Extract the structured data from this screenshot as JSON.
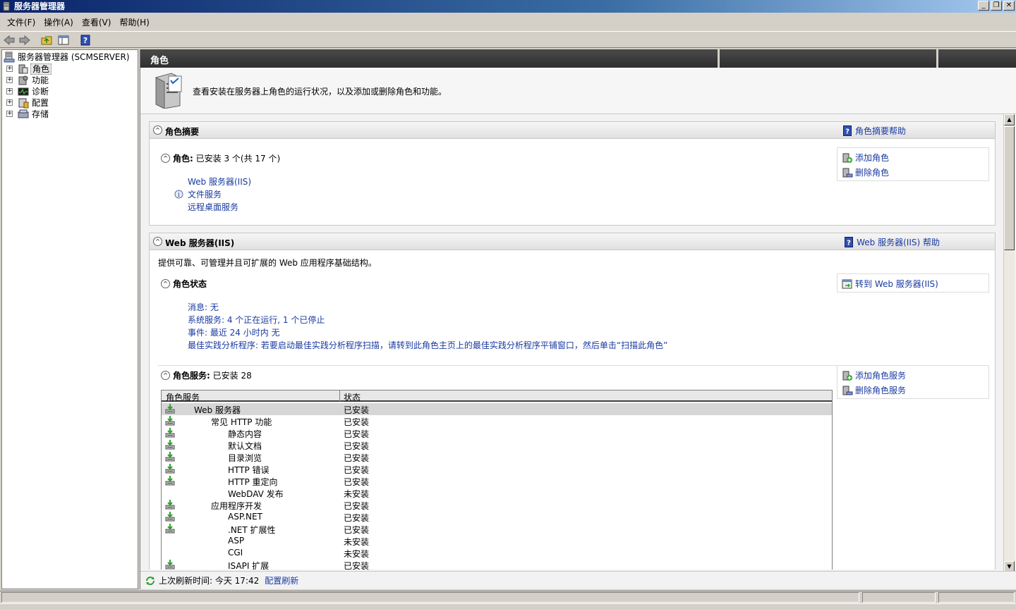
{
  "window": {
    "title": "服务器管理器"
  },
  "menu": [
    "文件(F)",
    "操作(A)",
    "查看(V)",
    "帮助(H)"
  ],
  "tree": {
    "root": "服务器管理器 (SCMSERVER)",
    "items": [
      "角色",
      "功能",
      "诊断",
      "配置",
      "存储"
    ]
  },
  "pane": {
    "header": "角色",
    "intro": "查看安装在服务器上角色的运行状况，以及添加或删除角色和功能。"
  },
  "summary": {
    "title": "角色摘要",
    "help": "角色摘要帮助",
    "roles_label": "角色:",
    "roles_count": "已安装 3 个(共 17 个)",
    "roles": [
      "Web 服务器(IIS)",
      "文件服务",
      "远程桌面服务"
    ],
    "actions": [
      "添加角色",
      "删除角色"
    ]
  },
  "web": {
    "title": "Web 服务器(IIS)",
    "help": "Web 服务器(IIS) 帮助",
    "description": "提供可靠、可管理并且可扩展的 Web 应用程序基础结构。",
    "status_title": "角色状态",
    "goto": "转到 Web 服务器(IIS)",
    "status_lines": [
      "消息: 无",
      "系统服务: 4 个正在运行, 1 个已停止",
      "事件: 最近 24 小时内 无",
      "最佳实践分析程序: 若要启动最佳实践分析程序扫描，请转到此角色主页上的最佳实践分析程序平铺窗口，然后单击“扫描此角色”"
    ],
    "services_label": "角色服务:",
    "services_count": "已安装 28",
    "services_actions": [
      "添加角色服务",
      "删除角色服务"
    ],
    "columns": [
      "角色服务",
      "状态"
    ],
    "rows": [
      {
        "name": "Web 服务器",
        "status": "已安装",
        "level": 1,
        "installed": true
      },
      {
        "name": "常见 HTTP 功能",
        "status": "已安装",
        "level": 2,
        "installed": true
      },
      {
        "name": "静态内容",
        "status": "已安装",
        "level": 3,
        "installed": true
      },
      {
        "name": "默认文档",
        "status": "已安装",
        "level": 3,
        "installed": true
      },
      {
        "name": "目录浏览",
        "status": "已安装",
        "level": 3,
        "installed": true
      },
      {
        "name": "HTTP 错误",
        "status": "已安装",
        "level": 3,
        "installed": true
      },
      {
        "name": "HTTP 重定向",
        "status": "已安装",
        "level": 3,
        "installed": true
      },
      {
        "name": "WebDAV 发布",
        "status": "未安装",
        "level": 3,
        "installed": false
      },
      {
        "name": "应用程序开发",
        "status": "已安装",
        "level": 2,
        "installed": true
      },
      {
        "name": "ASP.NET",
        "status": "已安装",
        "level": 3,
        "installed": true
      },
      {
        "name": ".NET 扩展性",
        "status": "已安装",
        "level": 3,
        "installed": true
      },
      {
        "name": "ASP",
        "status": "未安装",
        "level": 3,
        "installed": false
      },
      {
        "name": "CGI",
        "status": "未安装",
        "level": 3,
        "installed": false
      },
      {
        "name": "ISAPI 扩展",
        "status": "已安装",
        "level": 3,
        "installed": true
      }
    ]
  },
  "refresh": {
    "label": "上次刷新时间: 今天 17:42",
    "link": "配置刷新"
  }
}
